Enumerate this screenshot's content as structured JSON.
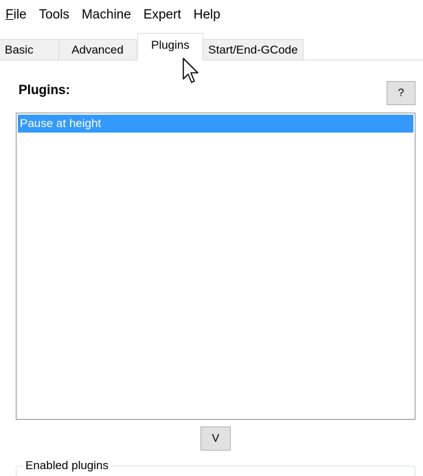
{
  "menubar": {
    "items": [
      {
        "label": "File",
        "mnemonic": "F",
        "rest": "ile"
      },
      {
        "label": "Tools"
      },
      {
        "label": "Machine"
      },
      {
        "label": "Expert"
      },
      {
        "label": "Help"
      }
    ]
  },
  "tabs": [
    {
      "label": "Basic"
    },
    {
      "label": "Advanced"
    },
    {
      "label": "Plugins",
      "active": true
    },
    {
      "label": "Start/End-GCode"
    }
  ],
  "plugins_panel": {
    "title": "Plugins:",
    "help_label": "?",
    "list": [
      {
        "label": "Pause at height",
        "selected": true
      }
    ],
    "add_button_label": "V",
    "enabled_group_label": "Enabled plugins"
  },
  "colors": {
    "selection": "#3399ff",
    "button_face": "#e1e1e1",
    "tab_face": "#f0f0f0"
  },
  "icons": {
    "cursor": "mouse-pointer-icon"
  }
}
